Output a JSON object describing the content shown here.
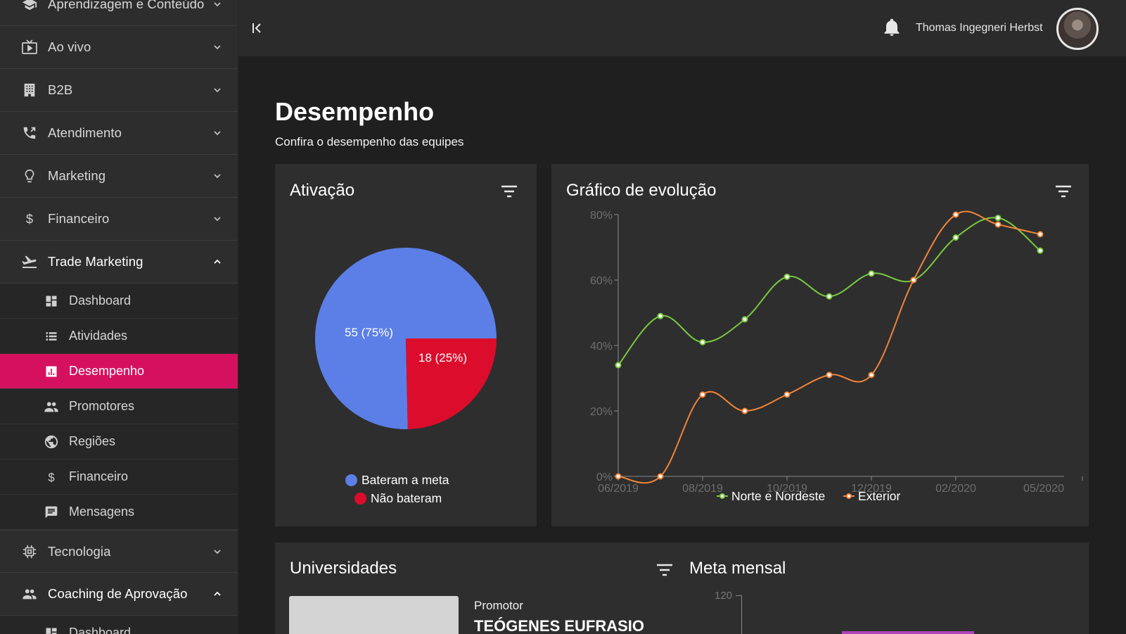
{
  "sidebar": {
    "groups_top": [
      {
        "label": "Aprendizagem e Conteúdo",
        "icon": "graduation-cap-icon"
      },
      {
        "label": "Ao vivo",
        "icon": "tv-icon"
      },
      {
        "label": "B2B",
        "icon": "building-icon"
      },
      {
        "label": "Atendimento",
        "icon": "phone-icon"
      },
      {
        "label": "Marketing",
        "icon": "lightbulb-icon"
      },
      {
        "label": "Financeiro",
        "icon": "dollar-icon"
      },
      {
        "label": "Trade Marketing",
        "icon": "airplane-icon"
      }
    ],
    "trade_marketing_items": [
      {
        "label": "Dashboard",
        "icon": "dashboard-icon"
      },
      {
        "label": "Atividades",
        "icon": "list-icon"
      },
      {
        "label": "Desempenho",
        "icon": "bar-chart-icon",
        "active": true
      },
      {
        "label": "Promotores",
        "icon": "people-icon"
      },
      {
        "label": "Regiões",
        "icon": "globe-icon"
      },
      {
        "label": "Financeiro",
        "icon": "dollar-icon"
      },
      {
        "label": "Mensagens",
        "icon": "message-icon"
      }
    ],
    "groups_bottom": [
      {
        "label": "Tecnologia",
        "icon": "chip-icon"
      },
      {
        "label": "Coaching de Aprovação",
        "icon": "people-icon"
      }
    ],
    "coaching_items": [
      {
        "label": "Dashboard",
        "icon": "dashboard-icon"
      }
    ]
  },
  "header": {
    "user_name": "Thomas Ingegneri Herbst"
  },
  "page": {
    "title": "Desempenho",
    "subtitle": "Confira o desempenho das equipes"
  },
  "cards": {
    "ativacao": {
      "title": "Ativação",
      "legend": [
        {
          "label": "Bateram a meta",
          "color": "#5b7fe6"
        },
        {
          "label": "Não bateram",
          "color": "#dc0d2c"
        }
      ]
    },
    "evolucao": {
      "title": "Gráfico de evolução"
    },
    "universidades": {
      "title": "Universidades",
      "promotor_label": "Promotor",
      "promotor_name": "TEÓGENES EUFRASIO"
    },
    "meta_mensal": {
      "title": "Meta mensal",
      "axis_top_label": "120",
      "bar_color": "#b044b8"
    }
  },
  "chart_data": [
    {
      "type": "pie",
      "categories": [
        "Bateram a meta",
        "Não bateram"
      ],
      "values": [
        55,
        18
      ],
      "labels": [
        "55 (75%)",
        "18 (25%)"
      ],
      "colors": [
        "#5b7fe6",
        "#dc0d2c"
      ],
      "legend": "bottom"
    },
    {
      "type": "line",
      "x_ticks": [
        "06/2019",
        "08/2019",
        "10/2019",
        "12/2019",
        "02/2020",
        "05/2020"
      ],
      "x": [
        "06/2019",
        "07/2019",
        "08/2019",
        "09/2019",
        "10/2019",
        "11/2019",
        "12/2019",
        "01/2020",
        "02/2020",
        "03/2020",
        "04/2020"
      ],
      "y_ticks": [
        "0%",
        "20%",
        "40%",
        "60%",
        "80%"
      ],
      "ylim": [
        0,
        80
      ],
      "series": [
        {
          "name": "Norte e Nordeste",
          "color": "#78c93f",
          "values": [
            34,
            49,
            41,
            48,
            61,
            55,
            62,
            60,
            73,
            79,
            69
          ]
        },
        {
          "name": "Exterior",
          "color": "#f0843a",
          "values": [
            0,
            0,
            25,
            20,
            25,
            31,
            31,
            60,
            80,
            77,
            74
          ]
        }
      ],
      "legend": "bottom"
    }
  ]
}
